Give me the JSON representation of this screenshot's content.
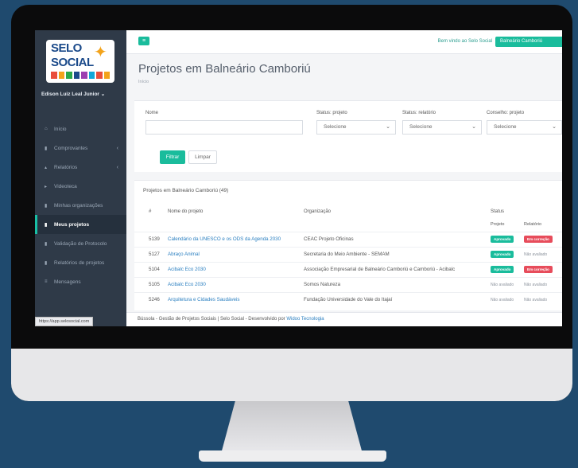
{
  "sidebar": {
    "logo_line1": "SELO",
    "logo_line2": "SOCIAL",
    "user": "Edison Luiz Leal Junior ⌄",
    "items": [
      {
        "label": "Início",
        "icon": "home-icon"
      },
      {
        "label": "Comprovantes",
        "icon": "file-icon"
      },
      {
        "label": "Relatórios",
        "icon": "chart-icon"
      },
      {
        "label": "Videoteca",
        "icon": "video-icon"
      },
      {
        "label": "Minhas organizações",
        "icon": "file-icon"
      },
      {
        "label": "Meus projetos",
        "icon": "file-icon",
        "active": true
      },
      {
        "label": "Validação de Protocolo",
        "icon": "file-icon"
      },
      {
        "label": "Relatórios de projetos",
        "icon": "file-icon"
      },
      {
        "label": "Mensagens",
        "icon": "message-icon"
      }
    ],
    "status_url": "https://app.selosocial.com"
  },
  "topbar": {
    "welcome": "Bem vindo ao Selo Social",
    "location_button": "Balneário Camboriú"
  },
  "page": {
    "title": "Projetos em Balneário Camboriú",
    "breadcrumb": "Início"
  },
  "filters": {
    "name_label": "Nome",
    "name_value": "",
    "status_projeto_label": "Status: projeto",
    "status_relatorio_label": "Status: relatório",
    "conselho_label": "Conselho: projeto",
    "select_placeholder": "Selecione",
    "filter_button": "Filtrar",
    "clear_button": "Limpar"
  },
  "table": {
    "title": "Projetos em Balneário Camboriú (49)",
    "headers": {
      "num": "#",
      "name": "Nome do projeto",
      "org": "Organização",
      "status": "Status"
    },
    "subheaders": {
      "projeto": "Projeto",
      "relatorio": "Relatório"
    },
    "rows": [
      {
        "id": "5139",
        "name": "Calendário da UNESCO e os ODS da Agenda 2030",
        "org": "CEAC Projeto Oficinas",
        "projeto": "Aprovado",
        "relatorio": "Em correção"
      },
      {
        "id": "5127",
        "name": "Abraço Animal",
        "org": "Secretaria do Meio Ambiente - SEMAM",
        "projeto": "Aprovado",
        "relatorio": "Não avaliado"
      },
      {
        "id": "5104",
        "name": "Acibalc Eco 2030",
        "org": "Associação Empresarial de Balneário Camboriú e Camboriú - Acibalc",
        "projeto": "Aprovado",
        "relatorio": "Em correção"
      },
      {
        "id": "5105",
        "name": "Acibalc Eco 2030",
        "org": "Somos Natureza",
        "projeto": "Não avaliado",
        "relatorio": "Não avaliado"
      },
      {
        "id": "5246",
        "name": "Arquitetura e Cidades Saudáveis",
        "org": "Fundação Universidade do Vale do Itajaí",
        "projeto": "Não avaliado",
        "relatorio": "Não avaliado"
      }
    ]
  },
  "footer": {
    "text": "Bússola - Gestão de Projetos Sociais | Selo Social - Desenvolvido por ",
    "link": "Widoo Tecnologia"
  }
}
